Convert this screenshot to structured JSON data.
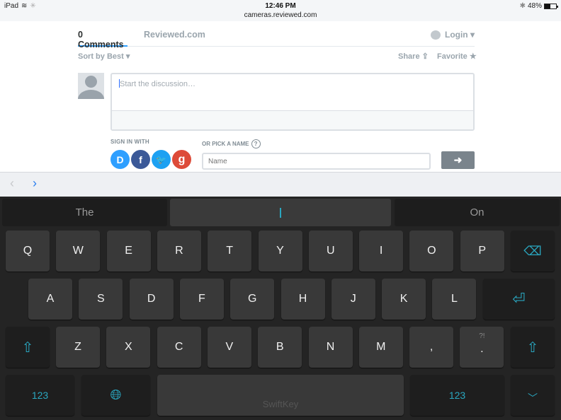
{
  "status_bar": {
    "device": "iPad",
    "time": "12:46 PM",
    "url": "cameras.reviewed.com",
    "battery_percent": "48%",
    "battery_level": 0.48
  },
  "disqus": {
    "tabs": [
      {
        "label": "0 Comments"
      },
      {
        "label": "Reviewed.com"
      }
    ],
    "login_label": "Login ▾",
    "sort_label": "Sort by Best ▾",
    "share_label": "Share",
    "favorite_label": "Favorite",
    "comment_placeholder": "Start the discussion…",
    "sign_in_label": "SIGN IN WITH",
    "social": [
      {
        "name": "disqus",
        "glyph": "D",
        "color": "#2e9fff"
      },
      {
        "name": "facebook",
        "glyph": "f",
        "color": "#3b5998"
      },
      {
        "name": "twitter",
        "glyph": "🐦",
        "color": "#1da1f2"
      },
      {
        "name": "google",
        "glyph": "g",
        "color": "#dd4b39"
      }
    ],
    "pick_name_label": "OR PICK A NAME",
    "help_glyph": "?",
    "name_placeholder": "Name",
    "submit_glyph": "➜"
  },
  "browser_nav": {
    "back": "‹",
    "forward": "›"
  },
  "keyboard": {
    "suggestions": [
      "The",
      "I",
      "On"
    ],
    "row1": [
      "Q",
      "W",
      "E",
      "R",
      "T",
      "Y",
      "U",
      "I",
      "O",
      "P"
    ],
    "row2": [
      "A",
      "S",
      "D",
      "F",
      "G",
      "H",
      "J",
      "K",
      "L"
    ],
    "row3": [
      "Z",
      "X",
      "C",
      "V",
      "B",
      "N",
      "M",
      ","
    ],
    "period_key": {
      "sub": "?!",
      "main": "."
    },
    "numbers_label": "123",
    "space_brand": "SwiftKey",
    "accent_color": "#2aa7c0"
  }
}
